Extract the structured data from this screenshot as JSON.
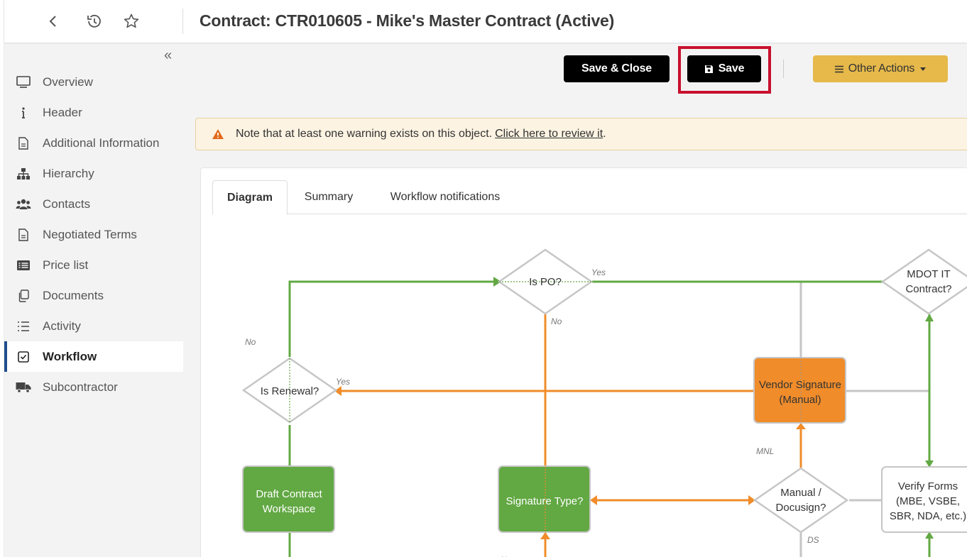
{
  "header": {
    "title": "Contract: CTR010605 - Mike's Master Contract (Active)"
  },
  "sidebar": {
    "items": [
      {
        "label": "Overview"
      },
      {
        "label": "Header"
      },
      {
        "label": "Additional Information"
      },
      {
        "label": "Hierarchy"
      },
      {
        "label": "Contacts"
      },
      {
        "label": "Negotiated Terms"
      },
      {
        "label": "Price list"
      },
      {
        "label": "Documents"
      },
      {
        "label": "Activity"
      },
      {
        "label": "Workflow",
        "active": true
      },
      {
        "label": "Subcontractor"
      }
    ]
  },
  "toolbar": {
    "save_close_label": "Save & Close",
    "save_label": "Save",
    "other_actions_label": "Other Actions"
  },
  "warning": {
    "text": "Note that at least one warning exists on this object.",
    "link": "Click here to review it",
    "suffix": "."
  },
  "tabs": [
    {
      "label": "Diagram",
      "active": true
    },
    {
      "label": "Summary"
    },
    {
      "label": "Workflow notifications"
    }
  ],
  "diagram": {
    "nodes": {
      "is_po": "Is PO?",
      "mdot_line1": "MDOT IT",
      "mdot_line2": "Contract?",
      "is_renewal": "Is Renewal?",
      "vendor_line1": "Vendor Signature",
      "vendor_line2": "(Manual)",
      "draft_line1": "Draft Contract",
      "draft_line2": "Workspace",
      "signature_type": "Signature Type?",
      "manual_line1": "Manual /",
      "manual_line2": "Docusign?",
      "verify_line1": "Verify Forms",
      "verify_line2": "(MBE, VSBE,",
      "verify_line3": "SBR, NDA, etc.)"
    },
    "edge_labels": {
      "yes_po": "Yes",
      "no_po": "No",
      "no_renewal": "No",
      "yes_renewal": "Yes",
      "mnl": "MNL",
      "ds": "DS",
      "no_bottom": "No"
    }
  },
  "colors": {
    "green": "#62a843",
    "orange": "#f08c2a",
    "gray_line": "#c6c6c6",
    "highlight": "#c8102e",
    "other_actions": "#e6b94a",
    "warning_icon": "#e36a1b"
  }
}
